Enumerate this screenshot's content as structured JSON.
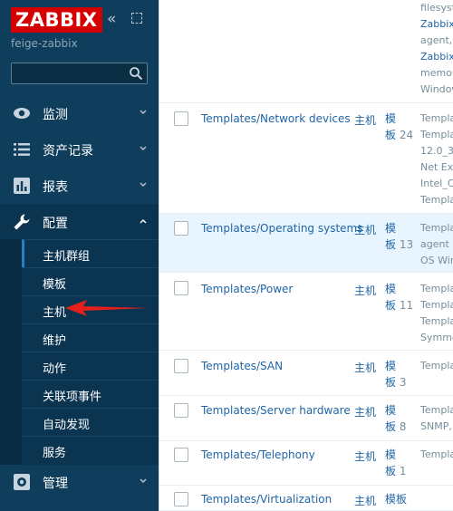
{
  "app": {
    "logo": "ZABBIX",
    "server_name": "feige-zabbix"
  },
  "search": {
    "placeholder": ""
  },
  "nav": {
    "monitoring": "监测",
    "inventory": "资产记录",
    "reports": "报表",
    "configuration": "配置",
    "administration": "管理"
  },
  "config_submenu": [
    "主机群组",
    "模板",
    "主机",
    "维护",
    "动作",
    "关联项事件",
    "自动发现",
    "服务"
  ],
  "table": {
    "top_partial_links": [
      "filesyst",
      "Zabbix",
      "agent,",
      "Zabbix",
      "memor",
      "Window"
    ],
    "rows": [
      {
        "name": "Templates/Network devices",
        "hosts": "主机",
        "templates": "模",
        "templates2": "板",
        "count": "24",
        "links": [
          "Templa",
          "Templa",
          "12.0_3",
          "Net Ex",
          "Intel_C",
          "Templa"
        ],
        "highlight": false
      },
      {
        "name": "Templates/Operating systems",
        "hosts": "主机",
        "templates": "模",
        "templates2": "板",
        "count": "13",
        "links": [
          "Templa",
          "agent a",
          "OS Wir"
        ],
        "highlight": true
      },
      {
        "name": "Templates/Power",
        "hosts": "主机",
        "templates": "模",
        "templates2": "板",
        "count": "11",
        "links": [
          "Templa",
          "Templa",
          "Templa",
          "Symme"
        ],
        "highlight": false
      },
      {
        "name": "Templates/SAN",
        "hosts": "主机",
        "templates": "模",
        "templates2": "板",
        "count": "3",
        "links": [
          "Templa"
        ],
        "highlight": false
      },
      {
        "name": "Templates/Server hardware",
        "hosts": "主机",
        "templates": "模",
        "templates2": "板",
        "count": "8",
        "links": [
          "Templa",
          "SNMP,"
        ],
        "highlight": false
      },
      {
        "name": "Templates/Telephony",
        "hosts": "主机",
        "templates": "模",
        "templates2": "板",
        "count": "1",
        "links": [
          "Templa"
        ],
        "highlight": false
      },
      {
        "name": "Templates/Virtualization",
        "hosts": "主机",
        "templates": "模板",
        "templates2": "",
        "count": "",
        "links": [],
        "highlight": false
      }
    ]
  },
  "colors": {
    "sidebar": "#0e3e5c",
    "link": "#1f65a6",
    "logo": "#d40000",
    "arrow": "#e5201b"
  },
  "icons": {
    "collapse": "double-chevron-left-icon",
    "kiosk": "fullscreen-icon",
    "search": "search-icon",
    "monitoring": "eye-icon",
    "inventory": "list-icon",
    "reports": "bar-chart-icon",
    "configuration": "wrench-icon",
    "administration": "gear-icon"
  }
}
